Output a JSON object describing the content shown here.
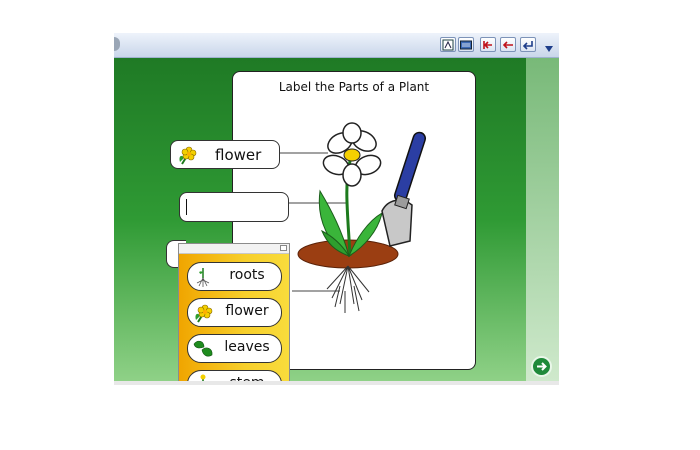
{
  "toolbar": {
    "buttons": [
      "symbol-tool-icon",
      "keyboard-icon",
      "go-start-icon",
      "go-back-icon",
      "return-icon",
      "dropdown-icon"
    ]
  },
  "status": {
    "text": ""
  },
  "worksheet": {
    "title": "Label the Parts of a Plant"
  },
  "labels": {
    "box1": "flower",
    "box2": "",
    "box3": ""
  },
  "word_bank": {
    "items": [
      {
        "label": "roots",
        "icon": "roots-icon"
      },
      {
        "label": "flower",
        "icon": "flower-icon"
      },
      {
        "label": "leaves",
        "icon": "leaves-icon"
      },
      {
        "label": "stem",
        "icon": "stem-icon"
      }
    ]
  },
  "colors": {
    "stage_green": "#2f9a34",
    "word_bank_yellow": "#f4c21e",
    "trowel_blue": "#2b3ea3"
  }
}
